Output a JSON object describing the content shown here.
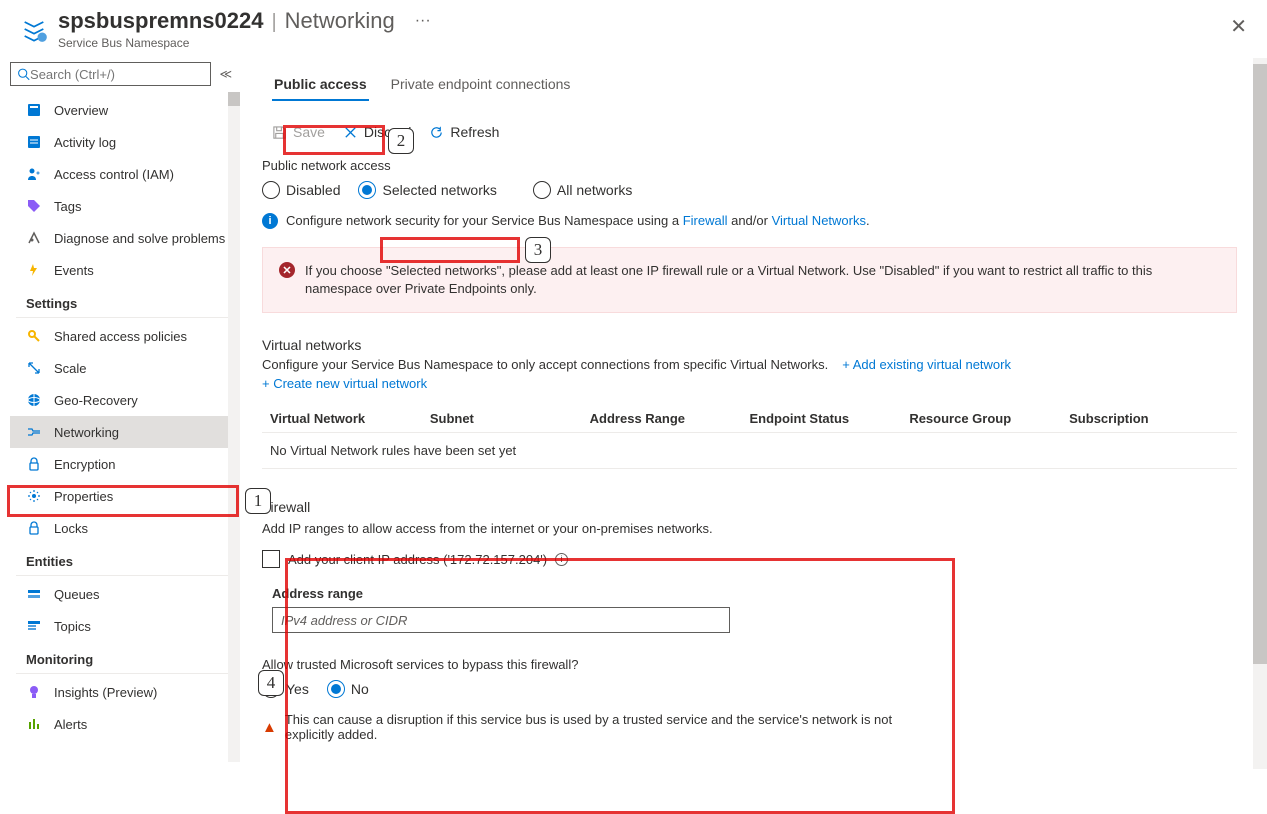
{
  "header": {
    "title": "spsbuspremns0224",
    "page": "Networking",
    "subtitle": "Service Bus Namespace",
    "ellipsis": "···"
  },
  "sidebar": {
    "search_placeholder": "Search (Ctrl+/)",
    "top_items": [
      {
        "label": "Overview",
        "name": "overview"
      },
      {
        "label": "Activity log",
        "name": "activity-log"
      },
      {
        "label": "Access control (IAM)",
        "name": "access-control"
      },
      {
        "label": "Tags",
        "name": "tags"
      },
      {
        "label": "Diagnose and solve problems",
        "name": "diagnose"
      },
      {
        "label": "Events",
        "name": "events"
      }
    ],
    "groups": [
      {
        "header": "Settings",
        "items": [
          {
            "label": "Shared access policies",
            "name": "shared-access-policies"
          },
          {
            "label": "Scale",
            "name": "scale"
          },
          {
            "label": "Geo-Recovery",
            "name": "geo-recovery"
          },
          {
            "label": "Networking",
            "name": "networking",
            "active": true
          },
          {
            "label": "Encryption",
            "name": "encryption"
          },
          {
            "label": "Properties",
            "name": "properties"
          },
          {
            "label": "Locks",
            "name": "locks"
          }
        ]
      },
      {
        "header": "Entities",
        "items": [
          {
            "label": "Queues",
            "name": "queues"
          },
          {
            "label": "Topics",
            "name": "topics"
          }
        ]
      },
      {
        "header": "Monitoring",
        "items": [
          {
            "label": "Insights (Preview)",
            "name": "insights"
          },
          {
            "label": "Alerts",
            "name": "alerts"
          }
        ]
      }
    ]
  },
  "tabs": {
    "public": "Public access",
    "private": "Private endpoint connections"
  },
  "toolbar": {
    "save": "Save",
    "discard": "Discard",
    "refresh": "Refresh"
  },
  "access": {
    "label": "Public network access",
    "disabled": "Disabled",
    "selected": "Selected networks",
    "all": "All networks"
  },
  "info": {
    "prefix": "Configure network security for your Service Bus Namespace using a ",
    "firewall": "Firewall",
    "mid": " and/or ",
    "vnet": "Virtual Networks",
    "suffix": "."
  },
  "error": {
    "text": "If you choose \"Selected networks\", please add at least one IP firewall rule or a Virtual Network. Use \"Disabled\" if you want to restrict all traffic to this namespace over Private Endpoints only."
  },
  "vnet": {
    "title": "Virtual networks",
    "desc": "Configure your Service Bus Namespace to only accept connections from specific Virtual Networks.",
    "add_existing": "+ Add existing virtual network",
    "create_new": "+ Create new virtual network",
    "cols": [
      "Virtual Network",
      "Subnet",
      "Address Range",
      "Endpoint Status",
      "Resource Group",
      "Subscription"
    ],
    "empty": "No Virtual Network rules have been set yet"
  },
  "firewall": {
    "title": "Firewall",
    "desc": "Add IP ranges to allow access from the internet or your on-premises networks.",
    "add_ip": "Add your client IP address ('172.72.157.204')",
    "range_label": "Address range",
    "range_placeholder": "IPv4 address or CIDR",
    "trusted_q": "Allow trusted Microsoft services to bypass this firewall?",
    "yes": "Yes",
    "no": "No",
    "warn": "This can cause a disruption if this service bus is used by a trusted service and the service's network is not explicitly added."
  },
  "callouts": {
    "c1": "1",
    "c2": "2",
    "c3": "3",
    "c4": "4"
  }
}
